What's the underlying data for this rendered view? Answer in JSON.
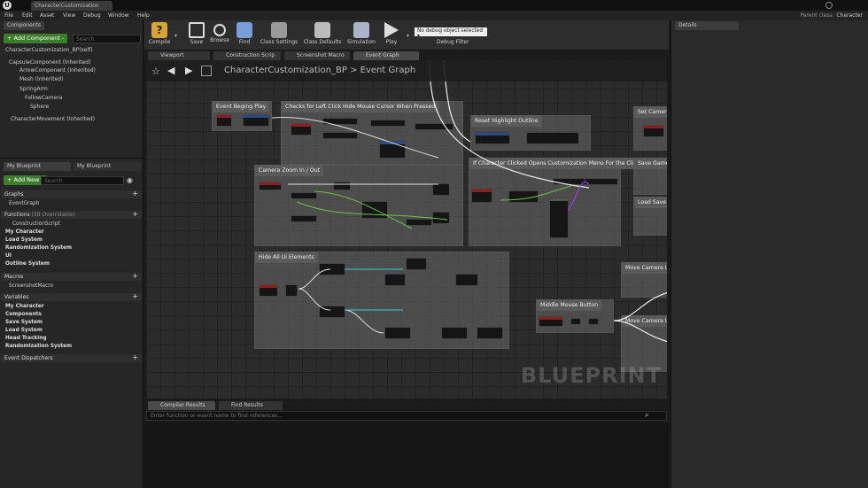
{
  "window": {
    "doc_tab": "CharacterCustomization",
    "parent_class_label": "Parent class:",
    "parent_class_value": "Character",
    "logo": "U"
  },
  "menu": [
    "File",
    "Edit",
    "Asset",
    "View",
    "Debug",
    "Window",
    "Help"
  ],
  "components_panel": {
    "tab": "Components",
    "add_button": "+ Add Component -",
    "search_placeholder": "Search",
    "self_item": "CharacterCustomization_BP(self)",
    "tree": [
      "CapsuleComponent (Inherited)",
      "ArrowComponent (Inherited)",
      "Mesh (Inherited)",
      "SpringArm",
      "FollowCamera",
      "Sphere",
      "CharacterMovement (Inherited)"
    ]
  },
  "myblueprint_panel": {
    "tabs": [
      "My Blueprint",
      "My Blueprint"
    ],
    "add_button": "+ Add New -",
    "search_placeholder": "Search",
    "graphs_header": "Graphs",
    "graphs": [
      "EventGraph"
    ],
    "functions_header": "Functions",
    "functions_count": "(38 Overridable)",
    "functions": [
      "ConstructionScript",
      "My Character",
      "Load System",
      "Randomization System",
      "UI",
      "Outline System"
    ],
    "macros_header": "Macros",
    "macros": [
      "ScreenshotMacro"
    ],
    "variables_header": "Variables",
    "variables": [
      "My Character",
      "Components",
      "Save System",
      "Load System",
      "Head Tracking",
      "Randomization System"
    ],
    "dispatchers_header": "Event Dispatchers"
  },
  "toolbar": {
    "compile": "Compile",
    "save": "Save",
    "browse": "Browse",
    "find": "Find",
    "class_settings": "Class Settings",
    "class_defaults": "Class Defaults",
    "simulation": "Simulation",
    "play": "Play",
    "debug_select": "No debug object selected ▾",
    "debug_filter": "Debug Filter"
  },
  "editor_tabs": [
    "Viewport",
    "Construction Scrip",
    "Screenshot Macro",
    "Event Graph"
  ],
  "graph": {
    "breadcrumb_root": "CharacterCustomization_BP",
    "breadcrumb_sep": ">",
    "breadcrumb_leaf": "Event Graph",
    "watermark": "BLUEPRINT",
    "comments": [
      "Event Beging Play",
      "Checks for Left Click Hide Mouse Cursor When Pressed",
      "Reset Highlight Outline",
      "Set Camera",
      "Camera Zoom In / Out",
      "If Character Clicked Opens Customization Menu For the Clicked Area",
      "Save Game",
      "Load Save",
      "Hide All Ui Elements",
      "Move Camera L",
      "Middle Mouse Button",
      "Move Camera U"
    ]
  },
  "bottom": {
    "tabs": [
      "Compiler Results",
      "Find Results"
    ],
    "search_placeholder": "Enter function or event name to find references..."
  },
  "details": {
    "tab": "Details"
  },
  "colors": {
    "accent_green": "#3c7d2b",
    "node_header_red": "#8a2020",
    "exec_white": "#ffffff",
    "pin_green": "#6ec04a",
    "pin_cyan": "#3fc9d9",
    "pin_purple": "#a040ff"
  }
}
